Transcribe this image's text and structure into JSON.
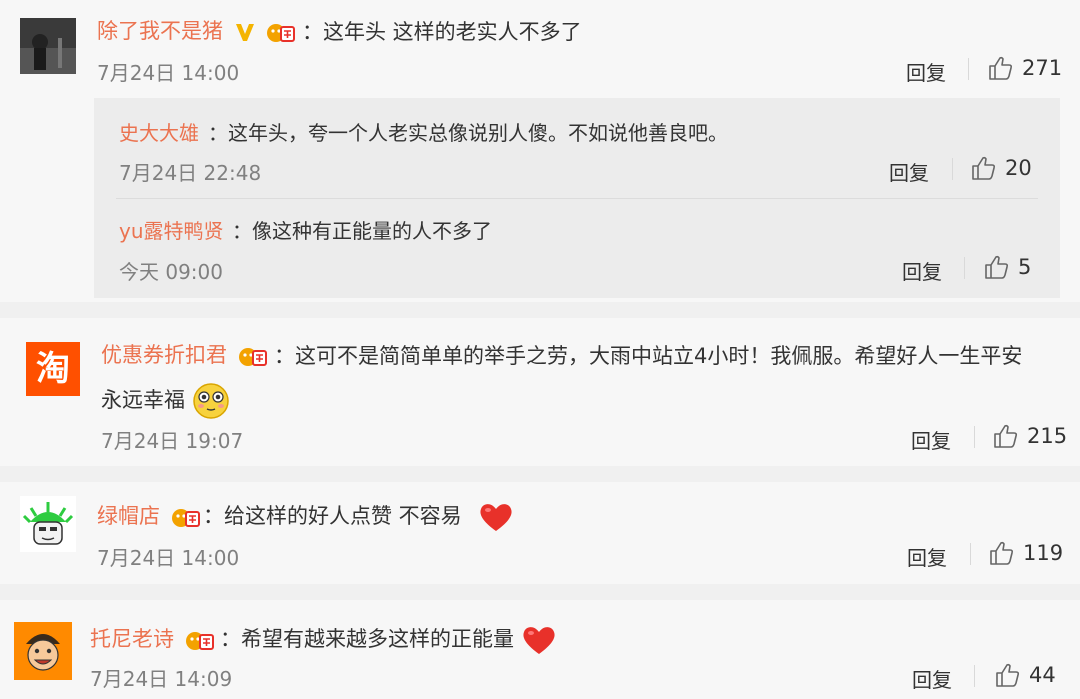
{
  "comments": [
    {
      "user": "除了我不是猪",
      "text": "：这年头 这样的老实人不多了",
      "time": "7月24日 14:00",
      "reply_label": "回复",
      "likes": "271",
      "replies": [
        {
          "user": "史大大雄",
          "text": "：这年头，夸一个人老实总像说别人傻。不如说他善良吧。",
          "time": "7月24日 22:48",
          "reply_label": "回复",
          "likes": "20"
        },
        {
          "user": "yu露特鸭贤",
          "text": "：像这种有正能量的人不多了",
          "time": "今天 09:00",
          "reply_label": "回复",
          "likes": "5"
        }
      ]
    },
    {
      "user": "优惠券折扣君",
      "text": "：这可不是简简单单的举手之劳，大雨中站立4小时！我佩服。希望好人一生平安",
      "text2": "永远幸福",
      "time": "7月24日 19:07",
      "reply_label": "回复",
      "likes": "215",
      "avatar_text": "淘"
    },
    {
      "user": "绿帽店",
      "text": "：给这样的好人点赞  不容易",
      "time": "7月24日 14:00",
      "reply_label": "回复",
      "likes": "119"
    },
    {
      "user": "托尼老诗",
      "text": "：希望有越来越多这样的正能量",
      "time": "7月24日 14:09",
      "reply_label": "回复",
      "likes": "44"
    }
  ],
  "colors": {
    "username": "#eb7350",
    "text": "#333333",
    "time": "#808080",
    "card_bg": "#f7f7f7",
    "page_bg": "#f0f0f0",
    "taobao_orange": "#ff5000",
    "vip_gold": "#f4b400",
    "heart_red": "#e8312a"
  },
  "icons": [
    "vip-v-icon",
    "member-badge-icon",
    "thumbs-up-icon",
    "heart-emoji-icon",
    "shy-face-emoji-icon"
  ]
}
